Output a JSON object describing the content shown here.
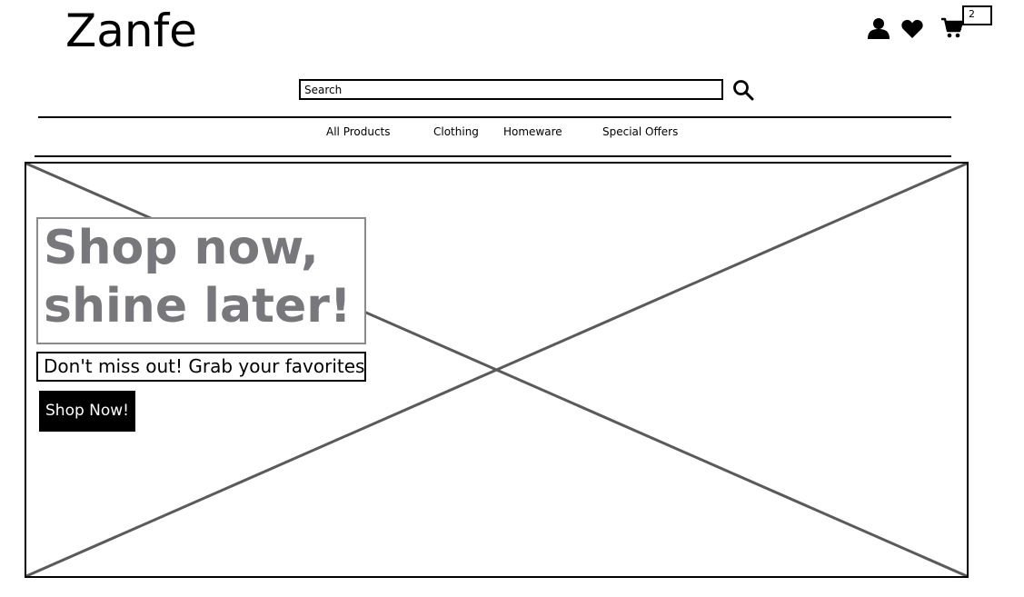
{
  "header": {
    "logo": "Zanfe",
    "cart_count": "2",
    "icons": [
      "user-icon",
      "heart-icon",
      "cart-icon"
    ]
  },
  "search": {
    "placeholder": "Search",
    "button_icon": "search-icon"
  },
  "nav": {
    "items": [
      {
        "label": "All Products"
      },
      {
        "label": "Clothing"
      },
      {
        "label": "Homeware"
      },
      {
        "label": "Special Offers"
      }
    ]
  },
  "hero": {
    "headline_line1": "Shop now,",
    "headline_line2": "shine later!",
    "subheading": "Don't miss out! Grab your favorites",
    "cta_label": "Shop Now!",
    "image": "image-placeholder"
  },
  "colors": {
    "text": "#000000",
    "headline": "#77777c",
    "headline_border": "#8a8a8e",
    "placeholder_lines": "#5a5a5a",
    "button_bg": "#000000",
    "button_text": "#ffffff"
  }
}
